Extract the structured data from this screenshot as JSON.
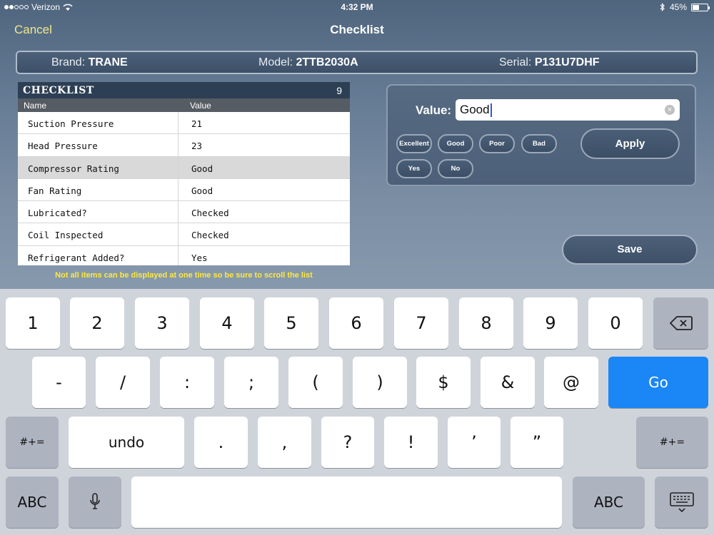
{
  "status_bar": {
    "carrier": "Verizon",
    "time": "4:32 PM",
    "battery_text": "45%",
    "battery_level": 0.45
  },
  "nav": {
    "cancel_label": "Cancel",
    "title": "Checklist"
  },
  "info": {
    "brand_label": "Brand:",
    "brand_value": "TRANE",
    "model_label": "Model:",
    "model_value": "2TTB2030A",
    "serial_label": "Serial:",
    "serial_value": "P131U7DHF"
  },
  "checklist": {
    "title": "CHECKLIST",
    "count": "9",
    "columns": {
      "name": "Name",
      "value": "Value"
    },
    "rows": [
      {
        "name": "Suction Pressure",
        "value": "21"
      },
      {
        "name": "Head Pressure",
        "value": "23"
      },
      {
        "name": "Compressor Rating",
        "value": "Good",
        "selected": true
      },
      {
        "name": "Fan Rating",
        "value": "Good"
      },
      {
        "name": "Lubricated?",
        "value": "Checked"
      },
      {
        "name": "Coil Inspected",
        "value": "Checked"
      },
      {
        "name": "Refrigerant Added?",
        "value": "Yes"
      }
    ],
    "note": "Not all items can be displayed at one time so be sure to scroll the list"
  },
  "value_panel": {
    "label": "Value:",
    "input_value": "Good",
    "chips": [
      "Excellent",
      "Good",
      "Poor",
      "Bad",
      "Yes",
      "No"
    ],
    "apply_label": "Apply"
  },
  "save_label": "Save",
  "keyboard": {
    "row1": [
      "1",
      "2",
      "3",
      "4",
      "5",
      "6",
      "7",
      "8",
      "9",
      "0"
    ],
    "row2": [
      "-",
      "/",
      ":",
      ";",
      "(",
      ")",
      "$",
      "&",
      "@"
    ],
    "go_label": "Go",
    "row3": [
      "undo",
      ".",
      ",",
      "?",
      "!",
      "’",
      "”"
    ],
    "more_symbols_label": "#+=",
    "abc_label": "ABC"
  }
}
